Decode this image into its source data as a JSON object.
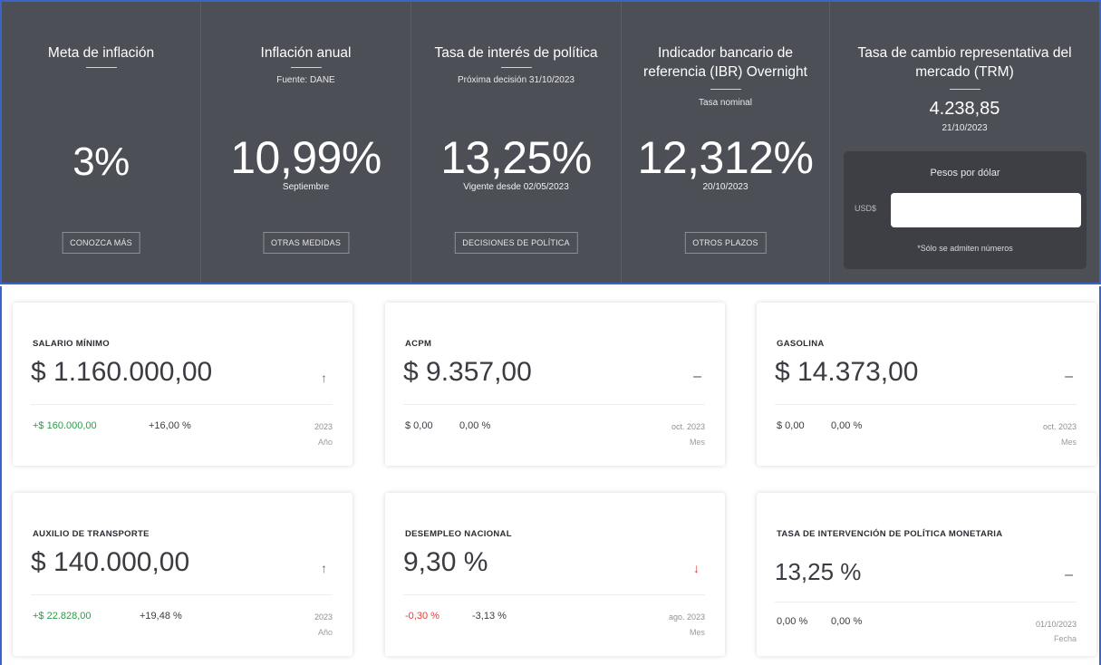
{
  "banner": {
    "inflation_target": {
      "title": "Meta de inflación",
      "value": "3%",
      "button": "CONOZCA MÁS"
    },
    "annual_inflation": {
      "title": "Inflación anual",
      "source": "Fuente: DANE",
      "value": "10,99%",
      "period": "Septiembre",
      "button": "OTRAS MEDIDAS"
    },
    "policy_rate": {
      "title": "Tasa de interés de política",
      "next_decision": "Próxima decisión 31/10/2023",
      "value": "13,25%",
      "since": "Vigente desde 02/05/2023",
      "button": "DECISIONES DE POLÍTICA"
    },
    "ibr": {
      "title": "Indicador bancario de referencia (IBR) Overnight",
      "note": "Tasa nominal",
      "value": "12,312%",
      "date": "20/10/2023",
      "button": "OTROS PLAZOS"
    },
    "trm": {
      "title": "Tasa de cambio representativa del mercado (TRM)",
      "value": "4.238,85",
      "date": "21/10/2023",
      "converter_title": "Pesos por dólar",
      "currency": "USD$",
      "input_value": "",
      "note": "*Sólo se admiten números"
    }
  },
  "cards": [
    {
      "label": "SALARIO MÍNIMO",
      "value": "$ 1.160.000,00",
      "trend": "up",
      "delta": "+$ 160.000,00",
      "pct": "+16,00 %",
      "period": "2023",
      "unit": "Año"
    },
    {
      "label": "ACPM",
      "value": "$ 9.357,00",
      "trend": "flat",
      "delta": "$ 0,00",
      "pct": "0,00 %",
      "period": "oct. 2023",
      "unit": "Mes"
    },
    {
      "label": "GASOLINA",
      "value": "$ 14.373,00",
      "trend": "flat",
      "delta": "$ 0,00",
      "pct": "0,00 %",
      "period": "oct. 2023",
      "unit": "Mes"
    },
    {
      "label": "AUXILIO DE TRANSPORTE",
      "value": "$ 140.000,00",
      "trend": "up",
      "delta": "+$ 22.828,00",
      "pct": "+19,48 %",
      "period": "2023",
      "unit": "Año"
    },
    {
      "label": "DESEMPLEO NACIONAL",
      "value": "9,30 %",
      "trend": "down",
      "delta": "-0,30 %",
      "pct": "-3,13 %",
      "period": "ago. 2023",
      "unit": "Mes"
    },
    {
      "label": "TASA DE INTERVENCIÓN DE POLÍTICA MONETARIA",
      "value": "13,25 %",
      "trend": "flat",
      "delta": "0,00 %",
      "pct": "0,00 %",
      "period": "01/10/2023",
      "unit": "Fecha"
    }
  ],
  "colors": {
    "banner_bg": "#4d4f57",
    "up": "#2e9a4a",
    "down": "#e0403a",
    "frame": "#3a64c8"
  },
  "icons": {
    "up": "arrow-up-icon",
    "down": "arrow-down-icon",
    "flat": "dash-icon"
  }
}
